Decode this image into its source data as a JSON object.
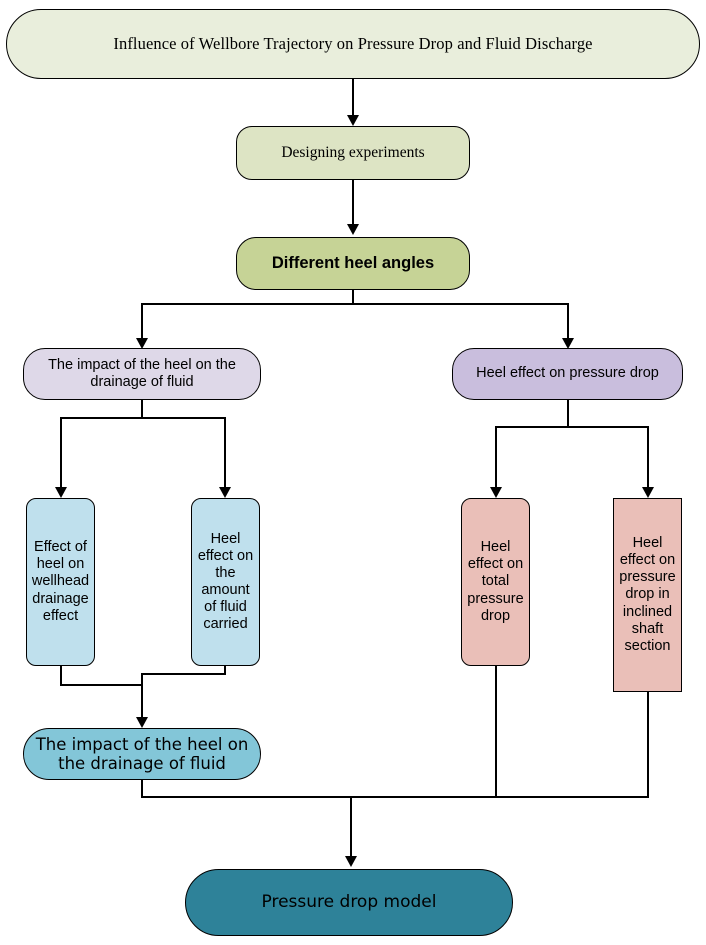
{
  "diagram": {
    "title": "Influence of Wellbore Trajectory on Pressure Drop and Fluid Discharge",
    "type": "flowchart",
    "orientation": "top-down",
    "background_color": "#ffffff",
    "connector_color": "#000000"
  },
  "nodes": {
    "root": {
      "label": "Influence of Wellbore Trajectory on Pressure Drop and Fluid Discharge",
      "fill": "#e9eedc",
      "shape": "stadium",
      "level": 0
    },
    "design": {
      "label": "Designing experiments",
      "fill": "#dde4c4",
      "shape": "rounded-rect",
      "level": 1
    },
    "angles": {
      "label": "Different heel angles",
      "fill": "#c6d396",
      "shape": "rounded-rect",
      "level": 2
    },
    "branch_left": {
      "label": "The impact of the heel on the drainage of fluid",
      "fill": "#ded8e8",
      "shape": "stadium",
      "level": 3
    },
    "branch_right": {
      "label": "Heel effect on pressure drop",
      "fill": "#c9bedd",
      "shape": "stadium",
      "level": 3
    },
    "leaf_1": {
      "label": "Effect of heel on wellhead drainage effect",
      "fill": "#bfe0ed",
      "shape": "rounded-rect",
      "level": 4
    },
    "leaf_2": {
      "label": "Heel effect on the amount of fluid carried",
      "fill": "#bfe0ed",
      "shape": "rounded-rect",
      "level": 4
    },
    "leaf_3": {
      "label": "Heel effect on total pressure drop",
      "fill": "#eabfb8",
      "shape": "rounded-rect",
      "level": 4
    },
    "leaf_4": {
      "label": "Heel effect on pressure drop in inclined shaft section",
      "fill": "#eabfb8",
      "shape": "rect",
      "level": 4
    },
    "merge_left": {
      "label": "The impact of the heel on the drainage of fluid",
      "fill": "#83c6d8",
      "shape": "stadium",
      "level": 5
    },
    "result": {
      "label": "Pressure drop model",
      "fill": "#2e8299",
      "shape": "stadium",
      "level": 6
    }
  },
  "edges": [
    {
      "from": "root",
      "to": "design"
    },
    {
      "from": "design",
      "to": "angles"
    },
    {
      "from": "angles",
      "to": "branch_left"
    },
    {
      "from": "angles",
      "to": "branch_right"
    },
    {
      "from": "branch_left",
      "to": "leaf_1"
    },
    {
      "from": "branch_left",
      "to": "leaf_2"
    },
    {
      "from": "branch_right",
      "to": "leaf_3"
    },
    {
      "from": "branch_right",
      "to": "leaf_4"
    },
    {
      "from": "leaf_1",
      "to": "merge_left"
    },
    {
      "from": "leaf_2",
      "to": "merge_left"
    },
    {
      "from": "merge_left",
      "to": "result"
    },
    {
      "from": "leaf_3",
      "to": "result"
    },
    {
      "from": "leaf_4",
      "to": "result"
    }
  ]
}
